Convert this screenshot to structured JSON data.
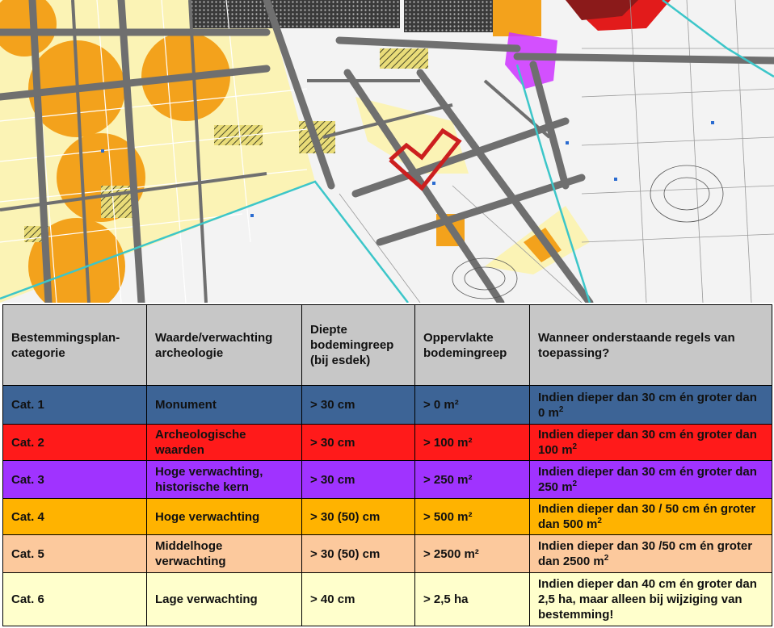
{
  "map": {
    "icons": [
      "site-marker-icon"
    ],
    "colors": {
      "background": "#f3f3f3",
      "road": "#6f6f6f",
      "lage_verwachting": "#fbf3b5",
      "hoge_verwachting": "#f3a21c",
      "historische_kern": "#cc33ff",
      "monument": "#8b1a1a",
      "archeologische_waarden": "#e21b1b",
      "plan_boundary": "#3cc6c9",
      "site_marker": "#cc1f1f",
      "hatched": "#4a4a2a"
    }
  },
  "table": {
    "headers": [
      "Bestemmingsplan-categorie",
      "Waarde/verwachting archeologie",
      "Diepte bodemingreep (bij esdek)",
      "Oppervlakte bodemingreep",
      "Wanneer onderstaande regels van toepassing?"
    ],
    "rows": [
      {
        "category": "Cat. 1",
        "value": "Monument",
        "depth": "> 30 cm",
        "area": "> 0 m²",
        "rule_text": "Indien dieper dan 30 cm én groter dan 0 m",
        "rule_sup": "2",
        "bg_color": "#3d6496",
        "text_color": "#111111"
      },
      {
        "category": "Cat. 2",
        "value": "Archeologische waarden",
        "depth": "> 30 cm",
        "area": "> 100 m²",
        "rule_text": "Indien dieper dan 30 cm én groter dan 100 m",
        "rule_sup": "2",
        "bg_color": "#ff1a1a",
        "text_color": "#111111"
      },
      {
        "category": "Cat. 3",
        "value": "Hoge verwachting, historische kern",
        "depth": "> 30 cm",
        "area": "> 250 m²",
        "rule_text": "Indien dieper dan 30 cm én groter dan 250 m",
        "rule_sup": "2",
        "bg_color": "#a033ff",
        "text_color": "#111111"
      },
      {
        "category": "Cat. 4",
        "value": "Hoge verwachting",
        "depth": "> 30 (50) cm",
        "area": "> 500 m²",
        "rule_text": "Indien dieper dan 30 / 50 cm én groter dan 500 m",
        "rule_sup": "2",
        "bg_color": "#ffb300",
        "text_color": "#111111"
      },
      {
        "category": "Cat. 5",
        "value": "Middelhoge verwachting",
        "depth": "> 30 (50) cm",
        "area": "> 2500 m²",
        "rule_text": "Indien dieper dan 30 /50 cm én groter dan 2500 m",
        "rule_sup": "2",
        "bg_color": "#fcc99d",
        "text_color": "#111111"
      },
      {
        "category": "Cat. 6",
        "value": "Lage verwachting",
        "depth": "> 40 cm",
        "area": "> 2,5 ha",
        "rule_text": "Indien dieper dan 40 cm én groter dan 2,5 ha, maar alleen bij wijziging van bestemming!",
        "rule_sup": "",
        "bg_color": "#ffffcc",
        "text_color": "#111111"
      }
    ],
    "header_bg": "#c7c7c7"
  }
}
